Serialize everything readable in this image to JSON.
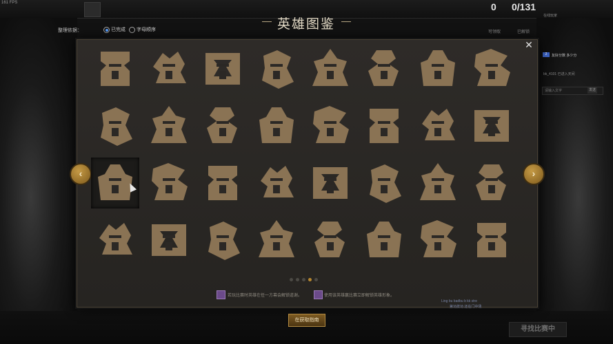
{
  "top": {
    "fps": "161 FPS",
    "counter_found": "0",
    "counter_total": "0/131",
    "counter_found_label": "可领取",
    "counter_unlocked_label": "已解锁"
  },
  "filter": {
    "label": "整理依据：",
    "options": [
      "已完成",
      "字母顺序"
    ],
    "selected": "已完成"
  },
  "dialog": {
    "title": "英雄图鉴",
    "close_glyph": "✕",
    "prev_glyph": "‹",
    "next_glyph": "›",
    "pagination": {
      "pages": 5,
      "current": 4
    },
    "hint_left": "若玩比赛时英雄在任一方幕会解锁道谢。",
    "hint_right": "使用该英雄赢比赛立即解锁英雄形象。",
    "user_line_1": "Ling bu badbu b kk stre",
    "user_line_2": "第功技功 还在门中场",
    "heroes": [
      [
        "hero-icon",
        "hero-icon",
        "hero-icon",
        "hero-icon",
        "hero-icon",
        "hero-icon",
        "hero-icon",
        "hero-icon"
      ],
      [
        "hero-icon",
        "hero-icon",
        "hero-icon",
        "hero-icon",
        "hero-icon",
        "hero-icon",
        "hero-icon",
        "hero-icon"
      ],
      [
        "hero-icon",
        "hero-icon",
        "hero-icon",
        "hero-icon",
        "hero-icon",
        "hero-icon",
        "hero-icon",
        "hero-icon"
      ],
      [
        "hero-icon",
        "hero-icon",
        "hero-icon",
        "hero-icon",
        "hero-icon",
        "hero-icon",
        "hero-icon",
        "hero-icon"
      ]
    ],
    "selected_cell": [
      2,
      0
    ]
  },
  "bottom": {
    "gold_button": "在获取指南",
    "find_match": "寻找比赛中"
  },
  "chat": {
    "header": "在线玩家",
    "line_1": "bk_4101 已进入天间",
    "placeholder": "请输入文字",
    "send": "发送",
    "badge": "2",
    "friend_line": "友好分数 多少分"
  },
  "colors": {
    "icon_bronze": "#8a7354",
    "gold_accent": "#b8882f",
    "panel_bg": "#2b2825"
  }
}
